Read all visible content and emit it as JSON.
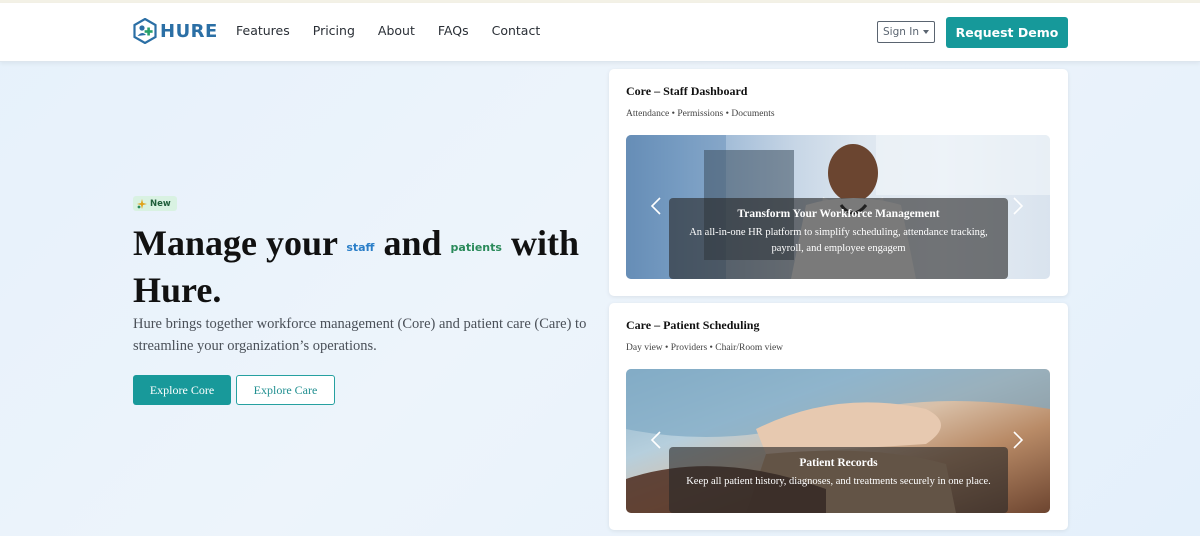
{
  "brand": {
    "name": "HURE",
    "primary_color": "#16999a",
    "logo_color": "#2b6fa5"
  },
  "nav": {
    "links": [
      "Features",
      "Pricing",
      "About",
      "FAQs",
      "Contact"
    ],
    "signin_label": "Sign In",
    "demo_label": "Request Demo"
  },
  "hero": {
    "badge": "New",
    "headline_part1": "Manage your",
    "rot_staff": "staff",
    "headline_part2": "and",
    "rot_patients": "patients",
    "headline_part3": "with Hure.",
    "subtext": "Hure brings together workforce management (Core) and patient care (Care) to streamline your organization’s operations.",
    "btn_core": "Explore Core",
    "btn_care": "Explore Care"
  },
  "cards": [
    {
      "title": "Core – Staff Dashboard",
      "subtitle": "Attendance • Permissions • Documents",
      "caption_title": "Transform Your Workforce Management",
      "caption_text": "An all-in-one HR platform to simplify scheduling, attendance tracking, payroll, and employee engagem"
    },
    {
      "title": "Care – Patient Scheduling",
      "subtitle": "Day view • Providers • Chair/Room view",
      "caption_title": "Patient Records",
      "caption_text": "Keep all patient history, diagnoses, and treatments securely in one place."
    }
  ]
}
